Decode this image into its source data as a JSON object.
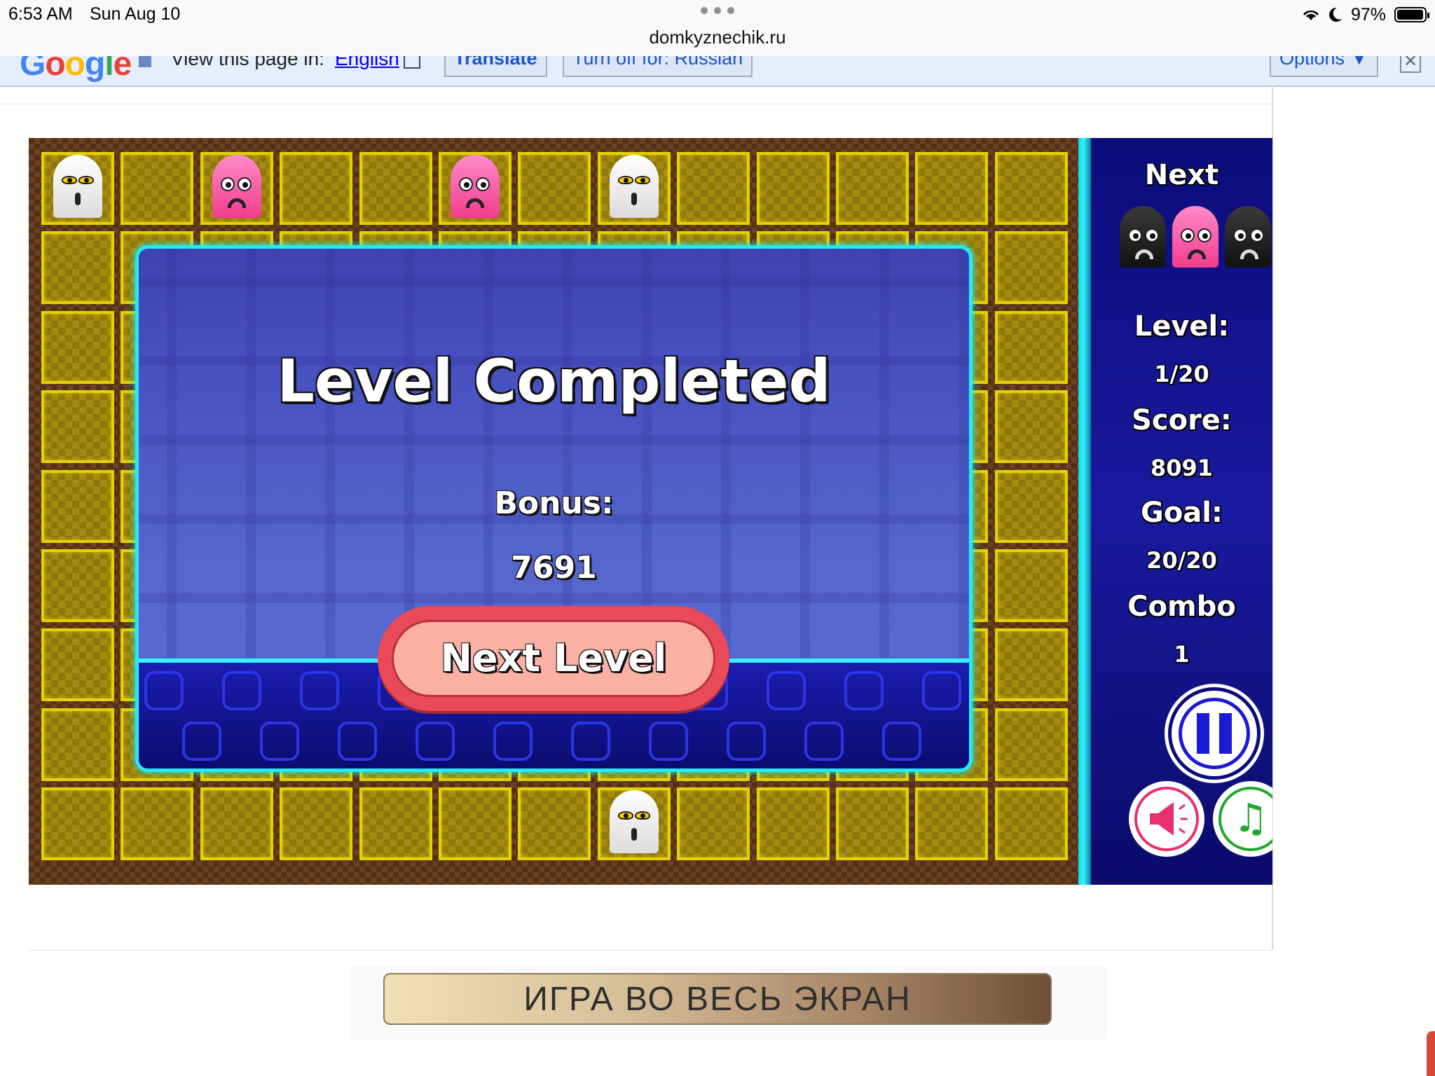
{
  "status_bar": {
    "time": "6:53 AM",
    "date": "Sun Aug 10",
    "url": "domkyznechik.ru",
    "battery": "97%",
    "battery_level": 0.97
  },
  "translate_bar": {
    "view_text": "View this page in:",
    "language": "English",
    "translate_button": "Translate",
    "turn_off_button": "Turn off for: Russian",
    "options_button": "Options ▼",
    "close": "✕"
  },
  "game": {
    "side_panel": {
      "next_label": "Next",
      "next_pieces": [
        "black",
        "pink",
        "black"
      ],
      "level_label": "Level:",
      "level_value": "1/20",
      "score_label": "Score:",
      "score_value": "8091",
      "goal_label": "Goal:",
      "goal_value": "20/20",
      "combo_label": "Combo",
      "combo_value": "1",
      "pause_icon": "pause-icon",
      "sound_icon": "speaker-icon",
      "music_icon": "music-note-icon"
    },
    "board": {
      "columns": 13,
      "rows": 9,
      "cell_color": "#e2d200"
    },
    "modal": {
      "title": "Level Completed",
      "bonus_label": "Bonus:",
      "bonus_value": "7691",
      "next_button": "Next Level"
    }
  },
  "fullscreen_button": "ИГРА ВО ВЕСЬ ЭКРАН",
  "colors": {
    "accent_cyan": "#27e8f8",
    "panel_blue": "#0b0c7a",
    "button_red": "#e84a5a"
  }
}
